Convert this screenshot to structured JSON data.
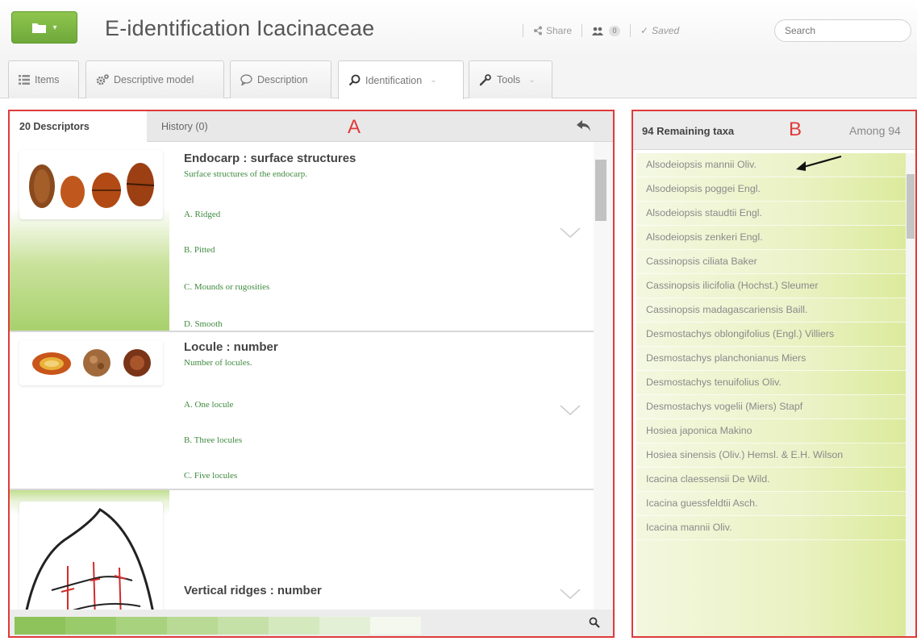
{
  "header": {
    "app_title": "E-identification Icacinaceae",
    "share_label": "Share",
    "users_count": "0",
    "saved_label": "Saved",
    "search_placeholder": "Search"
  },
  "tabs": [
    {
      "label": "Items"
    },
    {
      "label": "Descriptive model"
    },
    {
      "label": "Description"
    },
    {
      "label": "Identification"
    },
    {
      "label": "Tools"
    }
  ],
  "panel_a": {
    "marker": "A",
    "descriptors_tab": "20 Descriptors",
    "history_tab": "History (0)",
    "descriptors": [
      {
        "title": "Endocarp : surface structures",
        "subtitle": "Surface structures of the endocarp.",
        "states": [
          "A. Ridged",
          "B. Pitted",
          "C. Mounds or rugosities",
          "D. Smooth"
        ]
      },
      {
        "title": "Locule : number",
        "subtitle": "Number of locules.",
        "states": [
          "A. One locule",
          "B. Three locules",
          "C. Five locules"
        ]
      },
      {
        "title": "Vertical ridges : number",
        "subtitle": "",
        "states": []
      }
    ]
  },
  "panel_b": {
    "marker": "B",
    "remaining_label": "94 Remaining taxa",
    "among_label": "Among 94",
    "taxa": [
      "Alsodeiopsis mannii Oliv.",
      "Alsodeiopsis poggei Engl.",
      "Alsodeiopsis staudtii Engl.",
      "Alsodeiopsis zenkeri Engl.",
      "Cassinopsis ciliata Baker",
      "Cassinopsis ilicifolia (Hochst.) Sleumer",
      "Cassinopsis madagascariensis Baill.",
      "Desmostachys oblongifolius (Engl.) Villiers",
      "Desmostachys planchonianus Miers",
      "Desmostachys tenuifolius Oliv.",
      "Desmostachys vogelii (Miers) Stapf",
      "Hosiea japonica Makino",
      "Hosiea sinensis (Oliv.) Hemsl. & E.H. Wilson",
      "Icacina claessensii De Wild.",
      "Icacina guessfeldtii Asch.",
      "Icacina mannii Oliv."
    ]
  },
  "colors": {
    "accent_green": "#7ab648",
    "annotation_red": "#e03a3a",
    "taxa_bg": "#eaf2c3"
  }
}
